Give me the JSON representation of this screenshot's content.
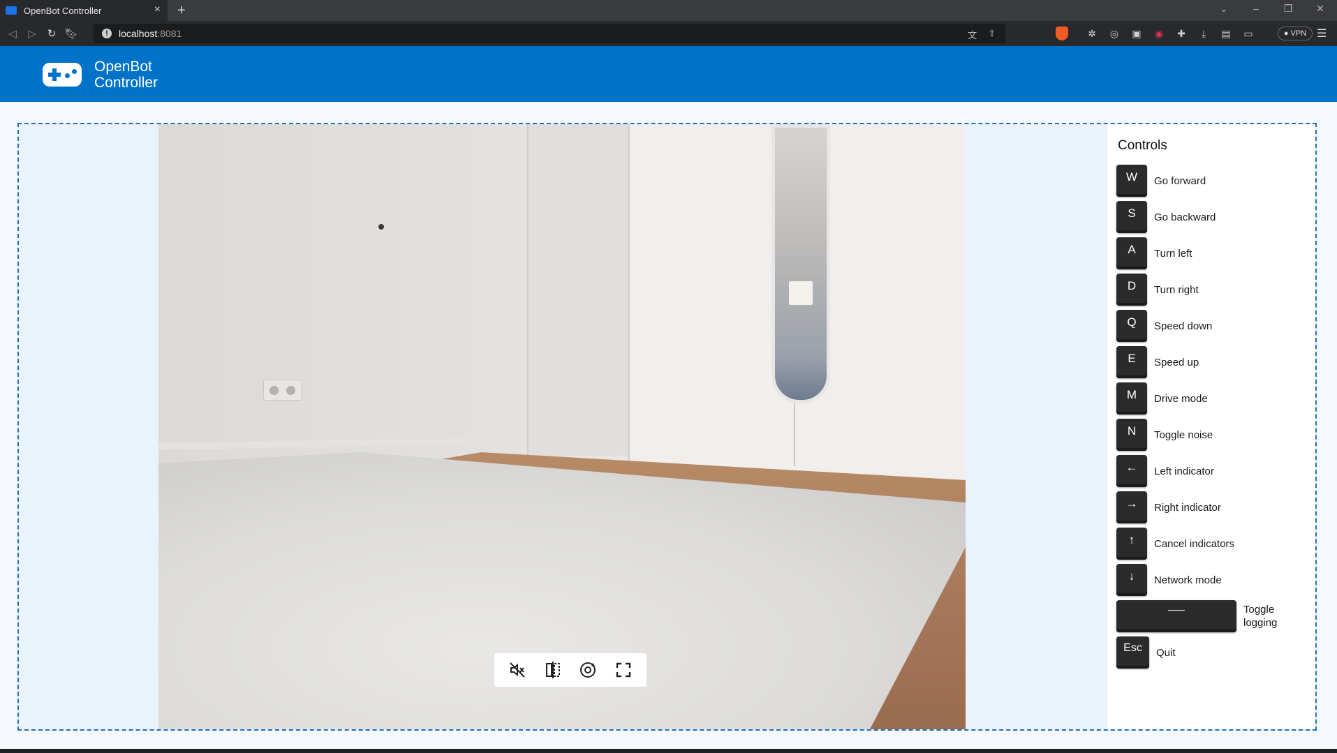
{
  "browser": {
    "tab_title": "OpenBot Controller",
    "tab_close_icon": "close-icon",
    "new_tab_icon": "plus-icon",
    "url_host": "localhost",
    "url_port": ":8081",
    "vpn_label": "VPN"
  },
  "app": {
    "brand_line1": "OpenBot",
    "brand_line2": "Controller"
  },
  "video_controls": {
    "icons": [
      "mute-icon",
      "mirror-icon",
      "rotate-camera-icon",
      "fullscreen-icon"
    ]
  },
  "controls": {
    "title": "Controls",
    "items": [
      {
        "key": "W",
        "label": "Go forward"
      },
      {
        "key": "S",
        "label": "Go backward"
      },
      {
        "key": "A",
        "label": "Turn left"
      },
      {
        "key": "D",
        "label": "Turn right"
      },
      {
        "key": "Q",
        "label": "Speed down"
      },
      {
        "key": "E",
        "label": "Speed up"
      },
      {
        "key": "M",
        "label": "Drive mode"
      },
      {
        "key": "N",
        "label": "Toggle noise"
      },
      {
        "key": "←",
        "label": "Left indicator"
      },
      {
        "key": "→",
        "label": "Right indicator"
      },
      {
        "key": "↑",
        "label": "Cancel indicators"
      },
      {
        "key": "↓",
        "label": "Network mode"
      },
      {
        "key": "",
        "label_line1": "Toggle",
        "label_line2": "logging"
      },
      {
        "key": "Esc",
        "label": "Quit"
      }
    ]
  },
  "colors": {
    "header_blue": "#0073c9",
    "stage_border": "#1f6fb9",
    "key_bg": "#2b2b2b"
  }
}
